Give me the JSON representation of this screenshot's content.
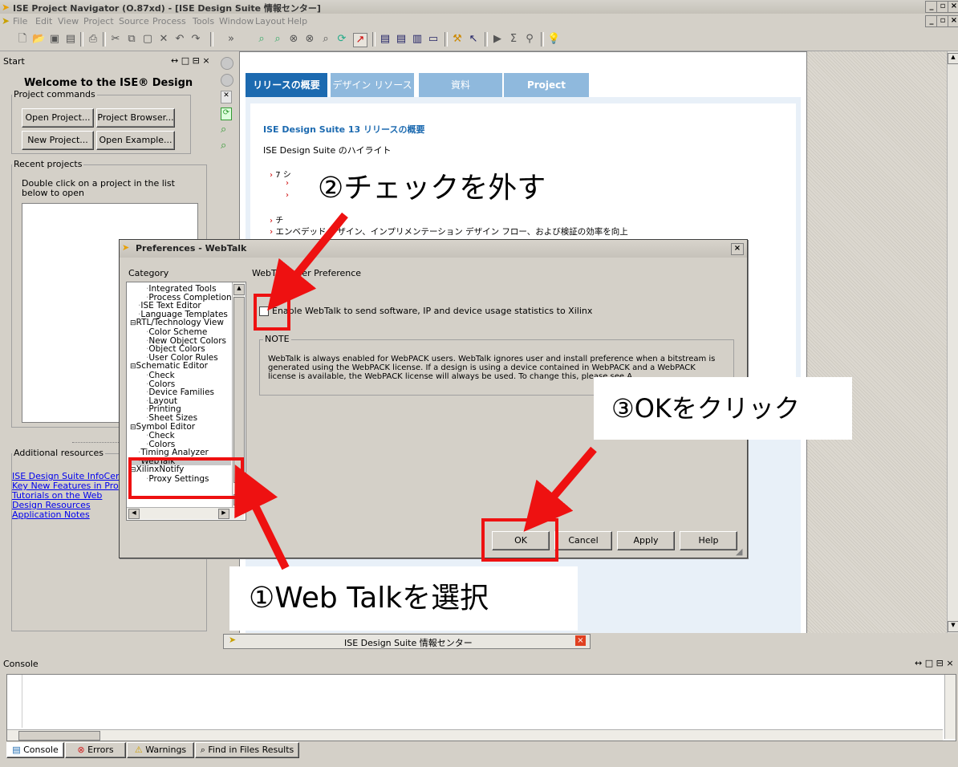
{
  "window": {
    "title": "ISE Project Navigator (O.87xd) - [ISE Design Suite 情報センター]",
    "menus": [
      "File",
      "Edit",
      "View",
      "Project",
      "Source",
      "Process",
      "Tools",
      "Window",
      "Layout",
      "Help"
    ],
    "controls": [
      "_",
      " ",
      "×"
    ]
  },
  "start_panel": {
    "title": "Start",
    "header_controls": "↔ □ ⊟ ×",
    "welcome": "Welcome to the ISE® Design Suite",
    "project_commands_legend": "Project commands",
    "buttons": {
      "open_project": "Open Project...",
      "project_browser": "Project Browser...",
      "new_project": "New Project...",
      "open_example": "Open Example..."
    },
    "recent_legend": "Recent projects",
    "recent_hint": "Double click on a project in the list below to open",
    "additional_legend": "Additional resources",
    "links": [
      "ISE Design Suite InfoCenter",
      "Key New Features in Pro",
      "Tutorials on the Web",
      "Design Resources",
      "Application Notes"
    ]
  },
  "info_center": {
    "tabs": [
      "リリースの概要",
      "デザイン リソース",
      "資料",
      "Project Navigator"
    ],
    "heading": "ISE Design Suite 13 リリースの概要",
    "highlights": "ISE Design Suite のハイライト",
    "bullet1": "7 シ",
    "bullet2": "チ",
    "bullet3": "エンベデッド デザイン、インプリメンテーション デザイン フロー、および検証の効率を向上",
    "doc_tab": "ISE Design Suite 情報センター"
  },
  "dialog": {
    "title": "Preferences - WebTalk",
    "category_label": "Category",
    "tree": [
      {
        "label": "Integrated Tools",
        "indent": 2
      },
      {
        "label": "Process Completion",
        "indent": 2
      },
      {
        "label": "ISE Text Editor",
        "indent": 1
      },
      {
        "label": "Language Templates",
        "indent": 1
      },
      {
        "label": "RTL/Technology View",
        "indent": 0,
        "exp": "⊟"
      },
      {
        "label": "Color Scheme",
        "indent": 2
      },
      {
        "label": "New Object Colors",
        "indent": 2
      },
      {
        "label": "Object Colors",
        "indent": 2
      },
      {
        "label": "User Color Rules",
        "indent": 2
      },
      {
        "label": "Schematic Editor",
        "indent": 0,
        "exp": "⊟"
      },
      {
        "label": "Check",
        "indent": 2
      },
      {
        "label": "Colors",
        "indent": 2
      },
      {
        "label": "Device Families",
        "indent": 2
      },
      {
        "label": "Layout",
        "indent": 2
      },
      {
        "label": "Printing",
        "indent": 2
      },
      {
        "label": "Sheet Sizes",
        "indent": 2
      },
      {
        "label": "Symbol Editor",
        "indent": 0,
        "exp": "⊟"
      },
      {
        "label": "Check",
        "indent": 2
      },
      {
        "label": "Colors",
        "indent": 2
      },
      {
        "label": "Timing Analyzer",
        "indent": 1
      },
      {
        "label": "WebTalk",
        "indent": 1
      },
      {
        "label": "XilinxNotify",
        "indent": 0,
        "exp": "⊟"
      },
      {
        "label": "Proxy Settings",
        "indent": 2
      }
    ],
    "preference_label": "WebTalk User Preference",
    "checkbox_label": "Enable WebTalk to send software, IP and device usage statistics to Xilinx",
    "checkbox_checked": false,
    "note_legend": "NOTE",
    "note_text": "WebTalk is always enabled for WebPACK users. WebTalk ignores user and install preference when a bitstream is generated using the WebPACK license. If a design is using a device contained in WebPACK and a WebPACK license is available, the WebPACK license will always be used. To change this, please see A",
    "buttons": {
      "ok": "OK",
      "cancel": "Cancel",
      "apply": "Apply",
      "help": "Help"
    }
  },
  "annotations": {
    "step1": "①Web Talkを選択",
    "step2": "②チェックを外す",
    "step3": "③OKをクリック",
    "color": "#ee1111"
  },
  "console": {
    "title": "Console",
    "header_controls": "↔ □ ⊟ ×",
    "tabs": [
      "Console",
      "Errors",
      "Warnings",
      "Find in Files Results"
    ]
  }
}
